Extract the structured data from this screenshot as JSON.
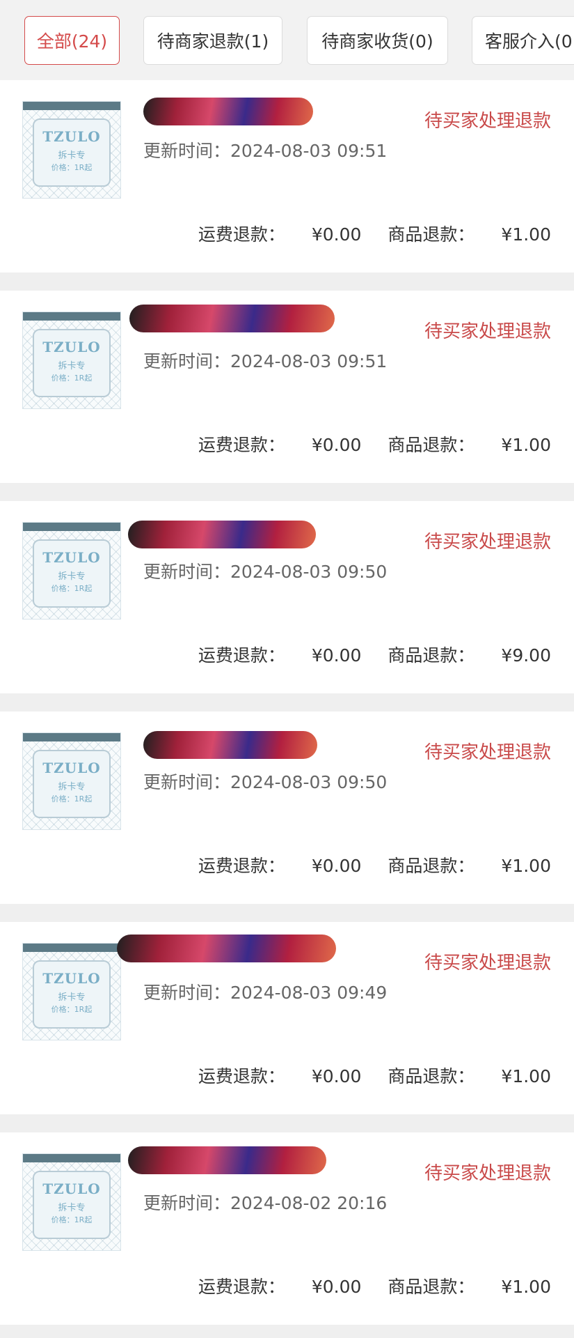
{
  "tabs": [
    {
      "label": "全部(24)",
      "active": true
    },
    {
      "label": "待商家退款(1)",
      "active": false
    },
    {
      "label": "待商家收货(0)",
      "active": false
    },
    {
      "label": "客服介入(0",
      "active": false
    }
  ],
  "thumbnail": {
    "logo": "TZULO",
    "subtitle": "拆卡专",
    "price": "价格：1R起"
  },
  "labels": {
    "updated_prefix": "更新时间：",
    "shipping_refund": "运费退款：",
    "goods_refund": "商品退款："
  },
  "colors": {
    "accent": "#c94a4a",
    "active_tab": "#d44a4a",
    "page_bg": "#efefef"
  },
  "orders": [
    {
      "status": "待买家处理退款",
      "updated_time": "2024-08-03 09:51",
      "shipping_refund": "¥0.00",
      "goods_refund": "¥1.00"
    },
    {
      "status": "待买家处理退款",
      "updated_time": "2024-08-03 09:51",
      "shipping_refund": "¥0.00",
      "goods_refund": "¥1.00"
    },
    {
      "status": "待买家处理退款",
      "updated_time": "2024-08-03 09:50",
      "shipping_refund": "¥0.00",
      "goods_refund": "¥9.00"
    },
    {
      "status": "待买家处理退款",
      "updated_time": "2024-08-03 09:50",
      "shipping_refund": "¥0.00",
      "goods_refund": "¥1.00"
    },
    {
      "status": "待买家处理退款",
      "updated_time": "2024-08-03 09:49",
      "shipping_refund": "¥0.00",
      "goods_refund": "¥1.00"
    },
    {
      "status": "待买家处理退款",
      "updated_time": "2024-08-02 20:16",
      "shipping_refund": "¥0.00",
      "goods_refund": "¥1.00"
    }
  ]
}
